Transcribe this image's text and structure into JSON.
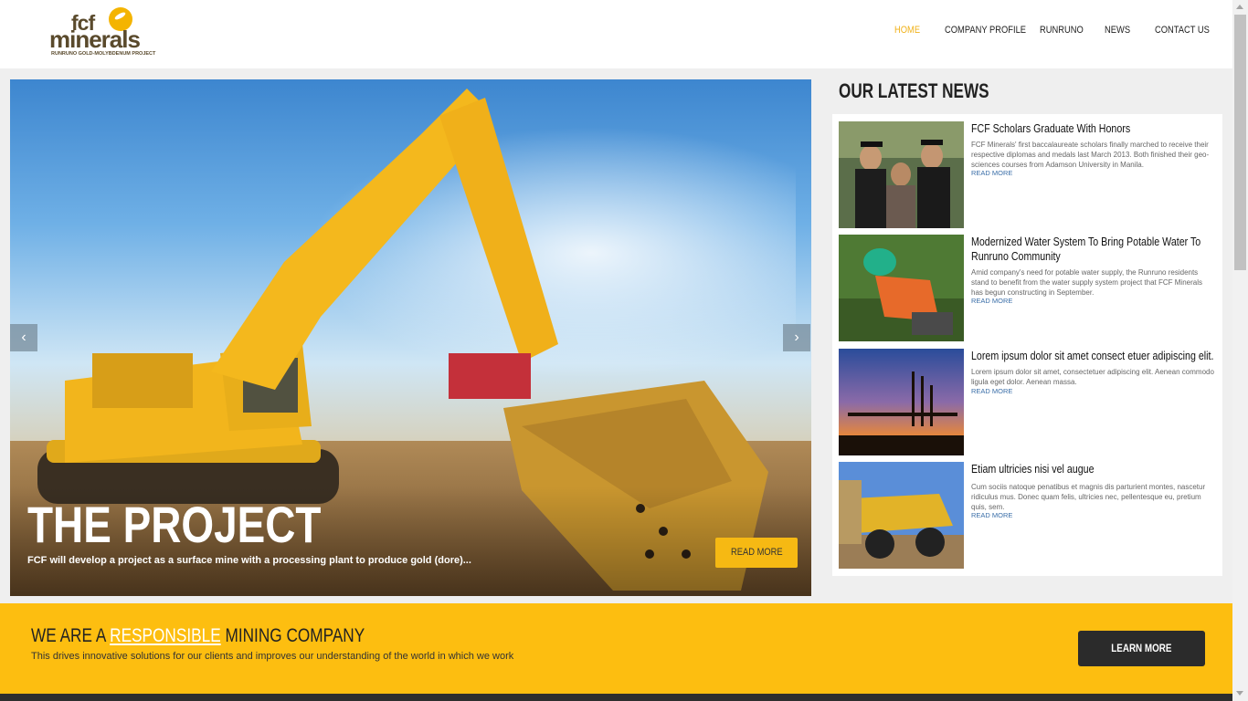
{
  "logo": {
    "line1": "fcf",
    "line2": "minerals",
    "tagline": "RUNRUNO GOLD-MOLYBDENUM PROJECT"
  },
  "nav": {
    "items": [
      "HOME",
      "COMPANY PROFILE",
      "RUNRUNO",
      "NEWS",
      "CONTACT US"
    ],
    "active": "HOME"
  },
  "slider": {
    "title": "THE PROJECT",
    "description": "FCF will develop a project as a surface mine with a processing plant to produce gold (dore)...",
    "button_label": "READ MORE",
    "prev_icon": "‹",
    "next_icon": "›"
  },
  "news": {
    "heading": "OUR LATEST NEWS",
    "items": [
      {
        "title": "FCF Scholars Graduate With Honors",
        "text": "FCF Minerals' first baccalaureate scholars finally marched to receive their respective diplomas and medals last March 2013. Both finished their geo-sciences courses from Adamson University in Manila.",
        "more": "READ MORE"
      },
      {
        "title": "Modernized Water System To Bring Potable Water To Runruno Community",
        "text": "Amid company's need for potable water supply, the Runruno residents stand to benefit from the water supply system project that FCF Minerals has begun constructing in September.",
        "more": "READ MORE"
      },
      {
        "title": "Lorem ipsum dolor sit amet consect etuer adipiscing elit.",
        "text": "Lorem ipsum dolor sit amet, consectetuer adipiscing elit. Aenean commodo ligula eget dolor. Aenean massa.",
        "more": "READ MORE"
      },
      {
        "title": "Etiam ultricies nisi vel augue",
        "text": "Cum sociis natoque penatibus et magnis dis parturient montes, nascetur ridiculus mus. Donec quam felis, ultricies nec, pellentesque eu, pretium quis, sem.",
        "more": "READ MORE"
      }
    ]
  },
  "banner": {
    "title_prefix": "WE ARE A ",
    "title_highlight": "RESPONSIBLE",
    "title_suffix": " MINING COMPANY",
    "subtitle": "This drives innovative solutions for our clients and improves our understanding of the world in which we work",
    "button_label": "LEARN MORE"
  },
  "colors": {
    "accent": "#fdbe10",
    "nav_active": "#f0b21a",
    "dark": "#2b2b2b",
    "link": "#3a6ea8"
  }
}
